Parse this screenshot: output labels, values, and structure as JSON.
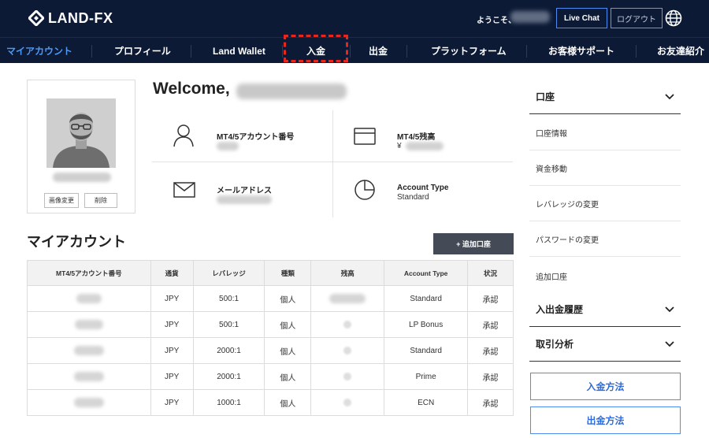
{
  "header": {
    "logo_text": "LAND-FX",
    "greeting": "ようこそ、",
    "live_chat_label": "Live Chat",
    "logout_label": "ログアウト",
    "accent_color": "#4f8cf0",
    "bar_color": "#0c1a36"
  },
  "nav": {
    "items": [
      {
        "label": "マイアカウント"
      },
      {
        "label": "プロフィール"
      },
      {
        "label": "Land Wallet"
      },
      {
        "label": "入金"
      },
      {
        "label": "出金"
      },
      {
        "label": "プラットフォーム"
      },
      {
        "label": "お客様サポート"
      },
      {
        "label": "お友達紹介"
      }
    ]
  },
  "profile": {
    "change_image_label": "画像変更",
    "delete_label": "削除"
  },
  "welcome": {
    "title": "Welcome,"
  },
  "info": {
    "account_number_label": "MT4/5アカウント番号",
    "balance_label": "MT4/5残高",
    "balance_currency": "¥",
    "email_label": "メールアドレス",
    "account_type_label": "Account Type",
    "account_type_value": "Standard"
  },
  "my_account": {
    "title": "マイアカウント",
    "add_account_label": "+ 追加口座",
    "columns": [
      "MT4/5アカウント番号",
      "通貨",
      "レバレッジ",
      "種類",
      "残高",
      "Account Type",
      "状況"
    ],
    "rows": [
      {
        "currency": "JPY",
        "leverage": "500:1",
        "kind": "個人",
        "type": "Standard",
        "status": "承認"
      },
      {
        "currency": "JPY",
        "leverage": "500:1",
        "kind": "個人",
        "type": "LP Bonus",
        "status": "承認"
      },
      {
        "currency": "JPY",
        "leverage": "2000:1",
        "kind": "個人",
        "type": "Standard",
        "status": "承認"
      },
      {
        "currency": "JPY",
        "leverage": "2000:1",
        "kind": "個人",
        "type": "Prime",
        "status": "承認"
      },
      {
        "currency": "JPY",
        "leverage": "1000:1",
        "kind": "個人",
        "type": "ECN",
        "status": "承認"
      }
    ]
  },
  "sidebar": {
    "account_section": "口座",
    "items": [
      "口座情報",
      "資金移動",
      "レバレッジの変更",
      "パスワードの変更",
      "追加口座"
    ],
    "deposit_history": "入出金履歴",
    "trade_analysis": "取引分析",
    "deposit_method": "入金方法",
    "withdraw_method": "出金方法"
  }
}
